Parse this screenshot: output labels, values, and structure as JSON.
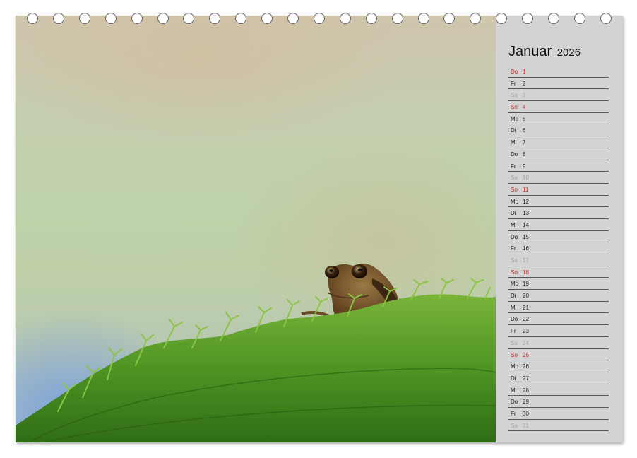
{
  "calendar": {
    "month": "Januar",
    "year": "2026",
    "days": [
      {
        "wd": "Do",
        "num": "1",
        "type": "sun"
      },
      {
        "wd": "Fr",
        "num": "2",
        "type": "normal"
      },
      {
        "wd": "Sa",
        "num": "3",
        "type": "sat"
      },
      {
        "wd": "So",
        "num": "4",
        "type": "sun"
      },
      {
        "wd": "Mo",
        "num": "5",
        "type": "normal"
      },
      {
        "wd": "Di",
        "num": "6",
        "type": "normal"
      },
      {
        "wd": "Mi",
        "num": "7",
        "type": "normal"
      },
      {
        "wd": "Do",
        "num": "8",
        "type": "normal"
      },
      {
        "wd": "Fr",
        "num": "9",
        "type": "normal"
      },
      {
        "wd": "Sa",
        "num": "10",
        "type": "sat"
      },
      {
        "wd": "So",
        "num": "11",
        "type": "sun"
      },
      {
        "wd": "Mo",
        "num": "12",
        "type": "normal"
      },
      {
        "wd": "Di",
        "num": "13",
        "type": "normal"
      },
      {
        "wd": "Mi",
        "num": "14",
        "type": "normal"
      },
      {
        "wd": "Do",
        "num": "15",
        "type": "normal"
      },
      {
        "wd": "Fr",
        "num": "16",
        "type": "normal"
      },
      {
        "wd": "Sa",
        "num": "17",
        "type": "sat"
      },
      {
        "wd": "So",
        "num": "18",
        "type": "sun"
      },
      {
        "wd": "Mo",
        "num": "19",
        "type": "normal"
      },
      {
        "wd": "Di",
        "num": "20",
        "type": "normal"
      },
      {
        "wd": "Mi",
        "num": "21",
        "type": "normal"
      },
      {
        "wd": "Do",
        "num": "22",
        "type": "normal"
      },
      {
        "wd": "Fr",
        "num": "23",
        "type": "normal"
      },
      {
        "wd": "Sa",
        "num": "24",
        "type": "sat"
      },
      {
        "wd": "So",
        "num": "25",
        "type": "sun"
      },
      {
        "wd": "Mo",
        "num": "26",
        "type": "normal"
      },
      {
        "wd": "Di",
        "num": "27",
        "type": "normal"
      },
      {
        "wd": "Mi",
        "num": "28",
        "type": "normal"
      },
      {
        "wd": "Do",
        "num": "29",
        "type": "normal"
      },
      {
        "wd": "Fr",
        "num": "30",
        "type": "normal"
      },
      {
        "wd": "Sa",
        "num": "31",
        "type": "sat"
      }
    ]
  },
  "colors": {
    "sunday": "#d6261f",
    "saturday": "#a2a2a2",
    "weekday": "#222222",
    "sidebar": "#d3d3d3"
  },
  "binding_ring_count": 23,
  "photo": {
    "subject": "frog-on-moss-photo"
  }
}
